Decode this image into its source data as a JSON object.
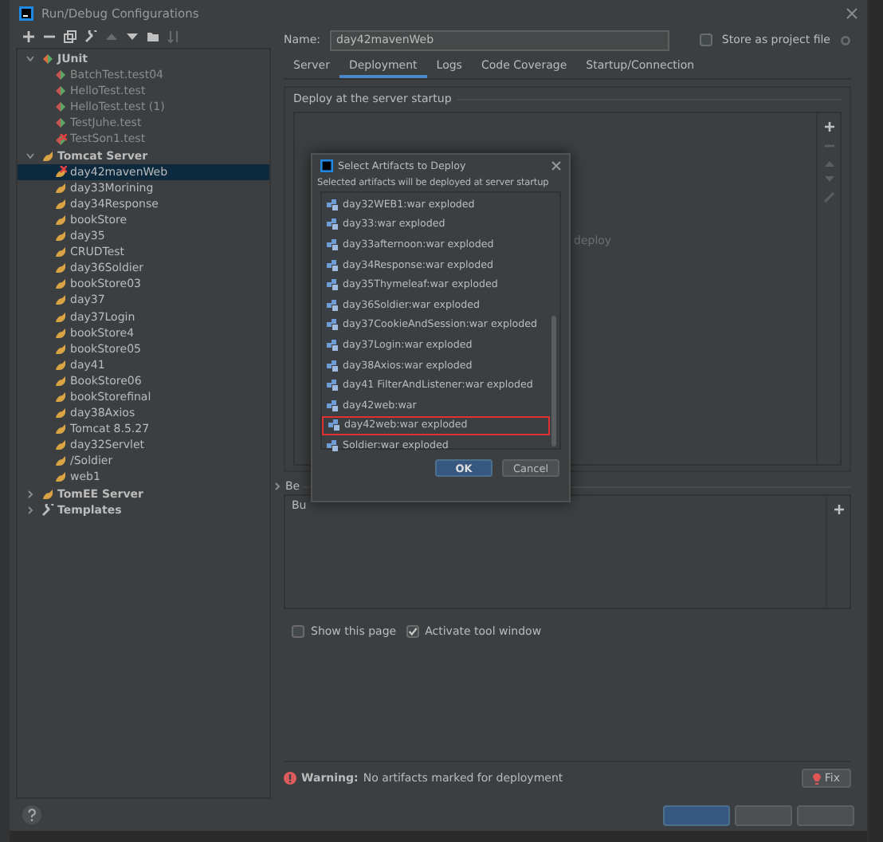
{
  "window": {
    "title": "Run/Debug Configurations"
  },
  "tree": [
    {
      "label": "JUnit",
      "kind": "junit-group",
      "expanded": true,
      "selected": false,
      "children": [
        {
          "label": "BatchTest.test04",
          "kind": "junit",
          "selected": false,
          "dimmed": true
        },
        {
          "label": "HelloTest.test",
          "kind": "junit",
          "selected": false,
          "dimmed": true
        },
        {
          "label": "HelloTest.test (1)",
          "kind": "junit",
          "selected": false,
          "dimmed": true
        },
        {
          "label": "TestJuhe.test",
          "kind": "junit",
          "selected": false,
          "dimmed": true
        },
        {
          "label": "TestSon1.test",
          "kind": "junit",
          "selected": false,
          "error": true,
          "dimmed": true
        }
      ]
    },
    {
      "label": "Tomcat Server",
      "kind": "tomcat-group",
      "expanded": true,
      "selected": false,
      "children": [
        {
          "label": "day42mavenWeb",
          "kind": "tomcat",
          "selected": true,
          "error": true
        },
        {
          "label": "day33Morining",
          "kind": "tomcat",
          "selected": false
        },
        {
          "label": "day34Response",
          "kind": "tomcat",
          "selected": false
        },
        {
          "label": "bookStore",
          "kind": "tomcat",
          "selected": false
        },
        {
          "label": "day35",
          "kind": "tomcat",
          "selected": false
        },
        {
          "label": "CRUDTest",
          "kind": "tomcat",
          "selected": false
        },
        {
          "label": "day36Soldier",
          "kind": "tomcat",
          "selected": false
        },
        {
          "label": "bookStore03",
          "kind": "tomcat",
          "selected": false
        },
        {
          "label": "day37",
          "kind": "tomcat",
          "selected": false
        },
        {
          "label": "day37Login",
          "kind": "tomcat",
          "selected": false
        },
        {
          "label": "bookStore4",
          "kind": "tomcat",
          "selected": false
        },
        {
          "label": "bookStore05",
          "kind": "tomcat",
          "selected": false
        },
        {
          "label": "day41",
          "kind": "tomcat",
          "selected": false
        },
        {
          "label": "BookStore06",
          "kind": "tomcat",
          "selected": false
        },
        {
          "label": "bookStorefinal",
          "kind": "tomcat",
          "selected": false
        },
        {
          "label": "day38Axios",
          "kind": "tomcat",
          "selected": false
        },
        {
          "label": "Tomcat 8.5.27",
          "kind": "tomcat",
          "selected": false
        },
        {
          "label": "day32Servlet",
          "kind": "tomcat",
          "selected": false
        },
        {
          "label": "/Soldier",
          "kind": "tomcat",
          "selected": false
        },
        {
          "label": "web1",
          "kind": "tomcat",
          "selected": false
        }
      ]
    },
    {
      "label": "TomEE Server",
      "kind": "tomcat-group",
      "expanded": false,
      "selected": false
    },
    {
      "label": "Templates",
      "kind": "templates",
      "expanded": false,
      "selected": false
    }
  ],
  "name_field": {
    "label": "Name:",
    "value": "day42mavenWeb"
  },
  "store_as_project_file": {
    "label": "Store as project file",
    "checked": false
  },
  "tabs": [
    {
      "label": "Server",
      "selected": false
    },
    {
      "label": "Deployment",
      "selected": true
    },
    {
      "label": "Logs",
      "selected": false
    },
    {
      "label": "Code Coverage",
      "selected": false
    },
    {
      "label": "Startup/Connection",
      "selected": false
    }
  ],
  "deploy_group": {
    "title": "Deploy at the server startup",
    "empty_text": "deploy"
  },
  "before_launch": {
    "title": "Be",
    "row": "Bu"
  },
  "checkboxes": [
    {
      "label": "Show this page",
      "checked": false
    },
    {
      "label": "Activate tool window",
      "checked": true
    }
  ],
  "warning": {
    "label": "Warning:",
    "text": "No artifacts marked for deployment",
    "button": "Fix"
  },
  "artifact_dialog": {
    "title": "Select Artifacts to Deploy",
    "hint": "Selected artifacts will be deployed at server startup",
    "items": [
      {
        "label": "day32WEB1:war exploded",
        "outlined": false
      },
      {
        "label": "day33:war exploded",
        "outlined": false
      },
      {
        "label": "day33afternoon:war exploded",
        "outlined": false
      },
      {
        "label": "day34Response:war exploded",
        "outlined": false
      },
      {
        "label": "day35Thymeleaf:war exploded",
        "outlined": false
      },
      {
        "label": "day36Soldier:war exploded",
        "outlined": false
      },
      {
        "label": "day37CookieAndSession:war exploded",
        "outlined": false
      },
      {
        "label": "day37Login:war exploded",
        "outlined": false
      },
      {
        "label": "day38Axios:war exploded",
        "outlined": false
      },
      {
        "label": "day41 FilterAndListener:war exploded",
        "outlined": false
      },
      {
        "label": "day42web:war",
        "outlined": false
      },
      {
        "label": "day42web:war exploded",
        "outlined": true
      },
      {
        "label": "Soldier:war exploded",
        "outlined": false
      }
    ],
    "buttons": [
      {
        "label": "OK",
        "kind": "primary"
      },
      {
        "label": "Cancel",
        "kind": "normal"
      }
    ]
  }
}
